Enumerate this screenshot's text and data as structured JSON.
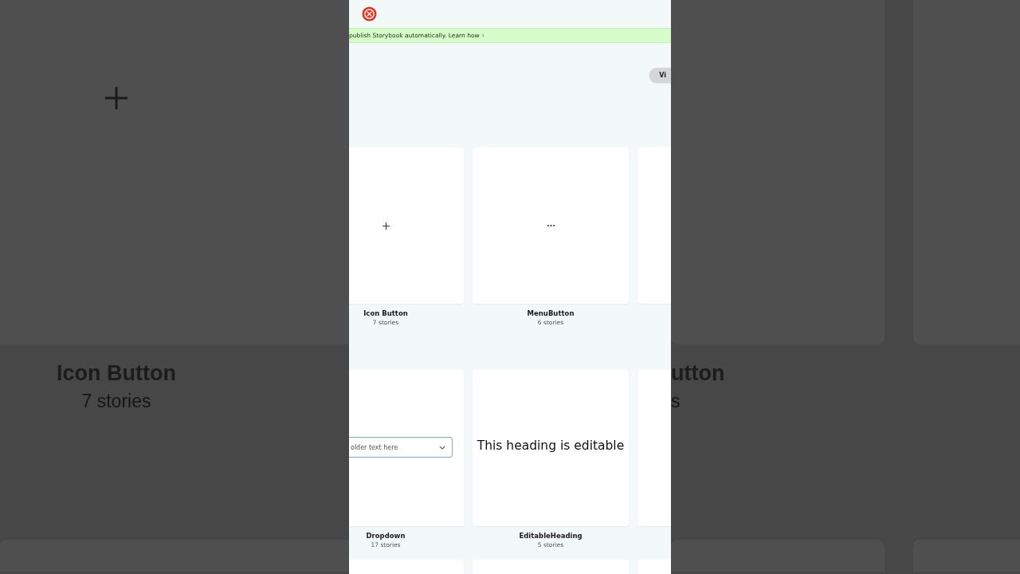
{
  "backdrop": {
    "left": {
      "title": "Icon Button",
      "count": "7 stories"
    },
    "right": {
      "title": "utton",
      "count": "s"
    }
  },
  "banner": {
    "text": "publish Storybook automatically. Learn how",
    "chevron": "›"
  },
  "view_button": "Vi",
  "components": [
    {
      "name": "Icon Button",
      "count": "7 stories",
      "preview": {
        "kind": "plus"
      }
    },
    {
      "name": "MenuButton",
      "count": "6 stories",
      "preview": {
        "kind": "dots"
      }
    },
    {
      "preview": {
        "kind": "blank"
      }
    },
    {
      "name": "Dropdown",
      "count": "17 stories",
      "preview": {
        "kind": "dropdown",
        "placeholder": "older text here"
      }
    },
    {
      "name": "EditableHeading",
      "count": "5 stories",
      "preview": {
        "kind": "heading",
        "text": "This heading is editable"
      }
    },
    {
      "preview": {
        "kind": "blank"
      }
    },
    {
      "preview": {
        "kind": "blank"
      }
    },
    {
      "preview": {
        "kind": "blank"
      }
    },
    {
      "preview": {
        "kind": "blank"
      }
    }
  ]
}
